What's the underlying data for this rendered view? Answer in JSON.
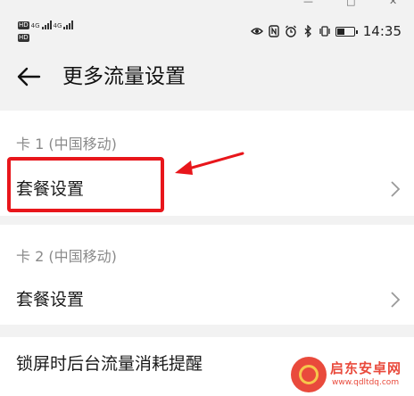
{
  "status_bar": {
    "sim1": {
      "hd": "HD",
      "network": "4G"
    },
    "sim2": {
      "hd": "HD",
      "network": "4G"
    },
    "icons": [
      "eye-comfort-icon",
      "nfc-icon",
      "alarm-icon",
      "bluetooth-icon",
      "vibrate-icon",
      "battery-icon"
    ],
    "battery_level": 0.45,
    "time": "14:35"
  },
  "header": {
    "title": "更多流量设置"
  },
  "sections": [
    {
      "header": "卡 1 (中国移动)",
      "row_label": "套餐设置"
    },
    {
      "header": "卡 2 (中国移动)",
      "row_label": "套餐设置"
    }
  ],
  "lockscreen_row": {
    "label": "锁屏时后台流量消耗提醒"
  },
  "annotation": {
    "color": "#e8161b"
  },
  "watermark": {
    "title": "启东安卓网",
    "url": "www.qdltdq.com"
  }
}
